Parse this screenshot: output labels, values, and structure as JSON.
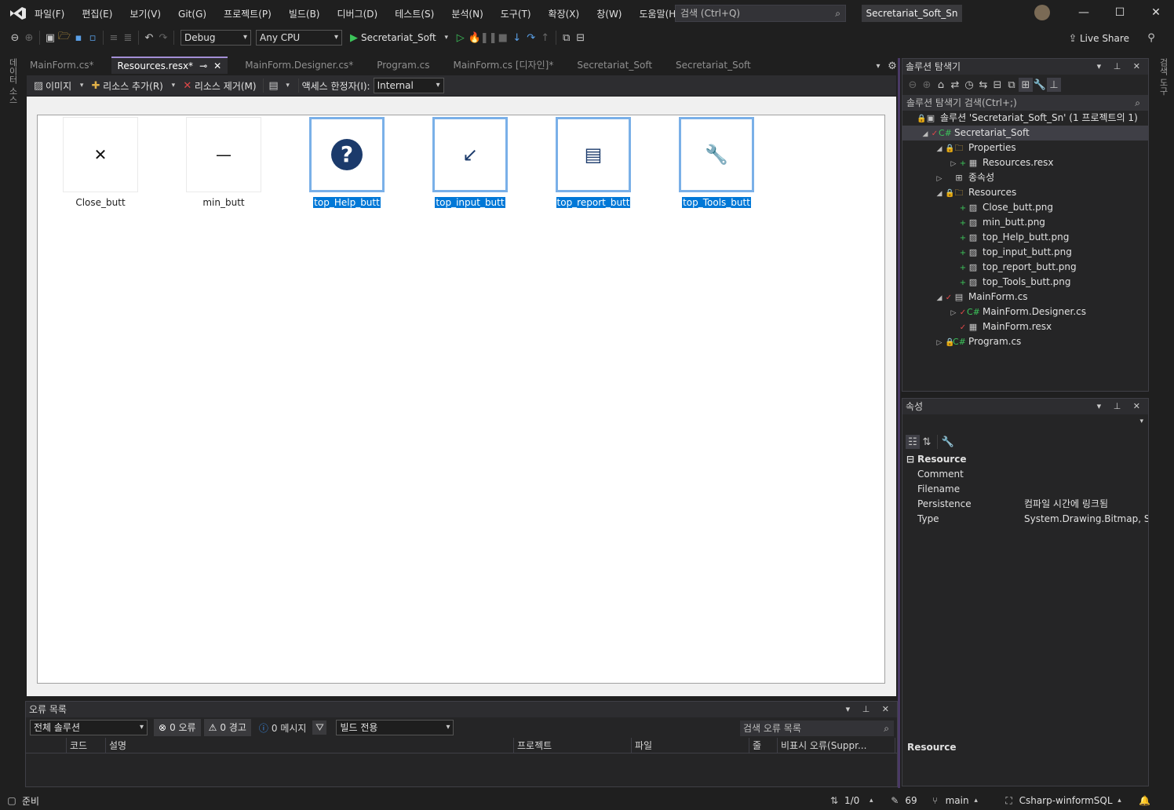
{
  "titlebar": {
    "menu": [
      "파일(F)",
      "편집(E)",
      "보기(V)",
      "Git(G)",
      "프로젝트(P)",
      "빌드(B)",
      "디버그(D)",
      "테스트(S)",
      "분석(N)",
      "도구(T)",
      "확장(X)",
      "창(W)",
      "도움말(H)"
    ],
    "search_placeholder": "검색 (Ctrl+Q)",
    "solution_name": "Secretariat_Soft_Sn",
    "window_controls": [
      "—",
      "☐",
      "✕"
    ]
  },
  "toolbar": {
    "config": "Debug",
    "platform": "Any CPU",
    "start_label": "Secretariat_Soft",
    "live_share": "Live Share"
  },
  "left_strip": "데이터 소스",
  "right_strip": "검색 도구",
  "tabs": [
    {
      "label": "MainForm.cs*",
      "active": false
    },
    {
      "label": "Resources.resx*",
      "active": true
    },
    {
      "label": "MainForm.Designer.cs*",
      "active": false
    },
    {
      "label": "Program.cs",
      "active": false
    },
    {
      "label": "MainForm.cs [디자인]*",
      "active": false
    },
    {
      "label": "Secretariat_Soft",
      "active": false
    },
    {
      "label": "Secretariat_Soft",
      "active": false
    }
  ],
  "res_toolbar": {
    "images": "이미지",
    "add_resource": "리소스 추가(R)",
    "remove_resource": "리소스 제거(M)",
    "access_modifier": "액세스 한정자(I):",
    "access_value": "Internal"
  },
  "resources": [
    {
      "name": "Close_butt",
      "glyph": "✕",
      "selected": false,
      "icon": "close-icon"
    },
    {
      "name": "min_butt",
      "glyph": "—",
      "selected": false,
      "icon": "minimize-icon"
    },
    {
      "name": "top_Help_butt",
      "glyph": "?",
      "selected": true,
      "icon": "help-icon"
    },
    {
      "name": "top_input_butt",
      "glyph": "↙",
      "selected": true,
      "icon": "input-icon"
    },
    {
      "name": "top_report_butt",
      "glyph": "▤",
      "selected": true,
      "icon": "report-icon"
    },
    {
      "name": "top_Tools_butt",
      "glyph": "🔧",
      "selected": true,
      "icon": "wrench-icon"
    }
  ],
  "error_list": {
    "title": "오류 목록",
    "scope": "전체 솔루션",
    "errors": "0 오류",
    "warnings": "0 경고",
    "messages": "0 메시지",
    "build_filter": "빌드 전용",
    "search_placeholder": "검색 오류 목록",
    "columns": [
      "코드",
      "설명",
      "프로젝트",
      "파일",
      "줄",
      "비표시 오류(Suppr..."
    ]
  },
  "solution_explorer": {
    "title": "솔루션 탐색기",
    "search_placeholder": "솔루션 탐색기 검색(Ctrl+;)",
    "rows": [
      {
        "indent": 0,
        "exp": "",
        "badge": "🔒",
        "icon": "▣",
        "label": "솔루션 'Secretariat_Soft_Sn' (1 프로젝트의 1)",
        "sel": false
      },
      {
        "indent": 1,
        "exp": "◢",
        "badge": "✓",
        "icon": "C#",
        "label": "Secretariat_Soft",
        "sel": true
      },
      {
        "indent": 2,
        "exp": "◢",
        "badge": "🔒",
        "icon": "🗀",
        "label": "Properties",
        "sel": false
      },
      {
        "indent": 3,
        "exp": "▷",
        "badge": "+",
        "icon": "▦",
        "label": "Resources.resx",
        "sel": false
      },
      {
        "indent": 2,
        "exp": "▷",
        "badge": "",
        "icon": "⊞",
        "label": "종속성",
        "sel": false
      },
      {
        "indent": 2,
        "exp": "◢",
        "badge": "🔒",
        "icon": "🗀",
        "label": "Resources",
        "sel": false
      },
      {
        "indent": 3,
        "exp": "",
        "badge": "+",
        "icon": "▨",
        "label": "Close_butt.png",
        "sel": false
      },
      {
        "indent": 3,
        "exp": "",
        "badge": "+",
        "icon": "▨",
        "label": "min_butt.png",
        "sel": false
      },
      {
        "indent": 3,
        "exp": "",
        "badge": "+",
        "icon": "▨",
        "label": "top_Help_butt.png",
        "sel": false
      },
      {
        "indent": 3,
        "exp": "",
        "badge": "+",
        "icon": "▨",
        "label": "top_input_butt.png",
        "sel": false
      },
      {
        "indent": 3,
        "exp": "",
        "badge": "+",
        "icon": "▨",
        "label": "top_report_butt.png",
        "sel": false
      },
      {
        "indent": 3,
        "exp": "",
        "badge": "+",
        "icon": "▨",
        "label": "top_Tools_butt.png",
        "sel": false
      },
      {
        "indent": 2,
        "exp": "◢",
        "badge": "✓",
        "icon": "▤",
        "label": "MainForm.cs",
        "sel": false
      },
      {
        "indent": 3,
        "exp": "▷",
        "badge": "✓",
        "icon": "C#",
        "label": "MainForm.Designer.cs",
        "sel": false
      },
      {
        "indent": 3,
        "exp": "",
        "badge": "✓",
        "icon": "▦",
        "label": "MainForm.resx",
        "sel": false
      },
      {
        "indent": 2,
        "exp": "▷",
        "badge": "🔒",
        "icon": "C#",
        "label": "Program.cs",
        "sel": false
      }
    ]
  },
  "properties": {
    "title": "속성",
    "category": "Resource",
    "rows": [
      {
        "name": "Comment",
        "value": ""
      },
      {
        "name": "Filename",
        "value": ""
      },
      {
        "name": "Persistence",
        "value": "컴파일 시간에 링크됨"
      },
      {
        "name": "Type",
        "value": "System.Drawing.Bitmap, Syst"
      }
    ],
    "description_title": "Resource"
  },
  "statusbar": {
    "ready": "준비",
    "position": "1/0",
    "changes": "69",
    "branch": "main",
    "repo": "Csharp-winformSQL"
  },
  "colors": {
    "accent": "#a48fd6",
    "selection": "#0078d7",
    "icon_blue": "#1b3a6b"
  }
}
